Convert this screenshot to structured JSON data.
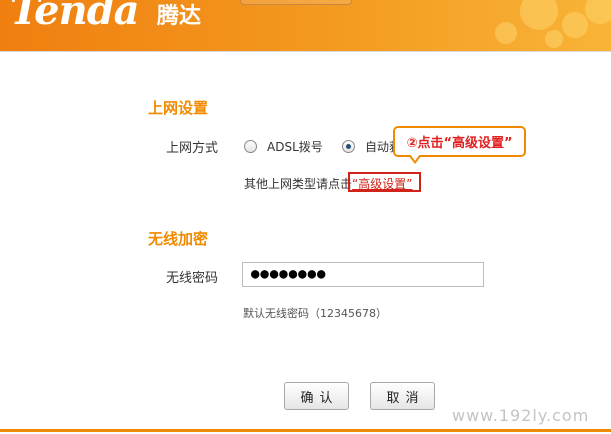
{
  "header": {
    "logo": "Tenda",
    "logo_cn": "腾达"
  },
  "internet": {
    "title": "上网设置",
    "mode_label": "上网方式",
    "options": [
      {
        "label": "ADSL拨号",
        "checked": false
      },
      {
        "label": "自动获",
        "checked": true
      }
    ],
    "other_text": "其他上网类型请点击",
    "advanced_link": "“高级设置”"
  },
  "annotation": {
    "text": "②点击“高级设置”"
  },
  "wireless": {
    "title": "无线加密",
    "password_label": "无线密码",
    "password_value": "●●●●●●●●",
    "hint": "默认无线密码（12345678）"
  },
  "buttons": {
    "confirm": "确认",
    "cancel": "取消"
  },
  "watermark": "www.192ly.com",
  "colors": {
    "accent": "#f08a00",
    "highlight": "#d2231a"
  }
}
